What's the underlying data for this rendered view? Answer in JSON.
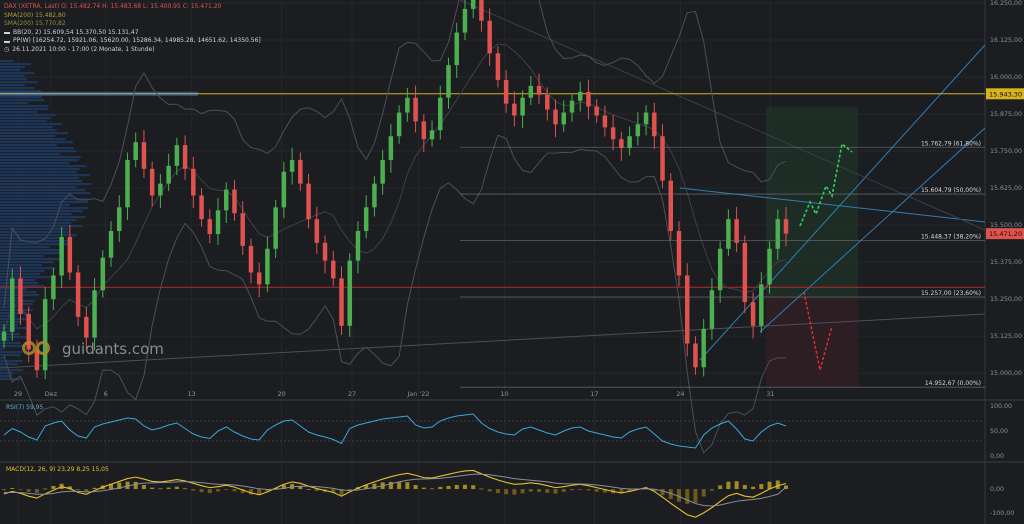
{
  "chart_data": {
    "type": "candlestick",
    "symbol_line": "DAX (XETRA, Last)  O: 15.482,74  H: 15.483,68  L: 15.400,95  C: 15.471,20",
    "legend": [
      {
        "text": "SMA(200)  15.482,80",
        "color": "#b59a3a"
      },
      {
        "text": "SMA(200)  15.770,82",
        "color": "#8a8f3a"
      },
      {
        "text": "BB(20, 2)  15.609,54  15.370,50  15.131,47",
        "color": "#cfd3d8"
      },
      {
        "text": "PP(W)  [16254.72, 15921.06, 15620.00, 15286.34, 14985.28, 14651.62, 14350.56]",
        "color": "#cfd3d8"
      },
      {
        "text": "26.11.2021 10:00 - 17:00  (2 Monate, 1 Stunde)",
        "color": "#cfd3d8"
      }
    ],
    "x_ticks": [
      "29",
      "Dez",
      "6",
      "13",
      "20",
      "27",
      "Jan '22",
      "10",
      "17",
      "24",
      "31"
    ],
    "y_ticks": [
      "16.250,00",
      "16.125,00",
      "16.000,00",
      "15.875,00",
      "15.750,00",
      "15.625,00",
      "15.500,00",
      "15.375,00",
      "15.250,00",
      "15.125,00",
      "15.000,00"
    ],
    "ylim": [
      14950,
      16260
    ],
    "price_close_series": [
      15140,
      15320,
      15200,
      15080,
      15010,
      15250,
      15330,
      15460,
      15340,
      15190,
      15120,
      15280,
      15390,
      15480,
      15560,
      15720,
      15780,
      15690,
      15600,
      15640,
      15700,
      15770,
      15690,
      15600,
      15520,
      15470,
      15550,
      15620,
      15540,
      15430,
      15340,
      15300,
      15420,
      15560,
      15680,
      15720,
      15640,
      15520,
      15440,
      15380,
      15320,
      15160,
      15380,
      15480,
      15560,
      15640,
      15720,
      15800,
      15880,
      15930,
      15850,
      15790,
      15820,
      15930,
      16040,
      16150,
      16230,
      16280,
      16190,
      16080,
      15990,
      15910,
      15870,
      15930,
      15970,
      15940,
      15890,
      15840,
      15880,
      15920,
      15950,
      15900,
      15870,
      15830,
      15790,
      15760,
      15800,
      15840,
      15880,
      15800,
      15650,
      15480,
      15330,
      15100,
      15020,
      15150,
      15280,
      15420,
      15520,
      15440,
      15240,
      15160,
      15300,
      15420,
      15520,
      15471.2
    ],
    "last_price": "15.471,20",
    "horizontal_line": {
      "label": "15.943,30",
      "value": 15943.3
    },
    "fibonacci": [
      {
        "label": "15.762,79 (61,80%)",
        "value": 15762.79
      },
      {
        "label": "15.604,79 (50,00%)",
        "value": 15604.79
      },
      {
        "label": "15.448,37 (38,20%)",
        "value": 15448.37
      },
      {
        "label": "15.257,00 (23,60%)",
        "value": 15257.0
      },
      {
        "label": "14.952,67 (0,00%)",
        "value": 14952.67
      }
    ],
    "rsi": {
      "label": "RSI(7)  59,95",
      "ticks": [
        "100,00",
        "50,00",
        "0,00"
      ],
      "ylim": [
        0,
        100
      ],
      "values": [
        42,
        55,
        48,
        38,
        32,
        60,
        66,
        70,
        52,
        40,
        36,
        58,
        64,
        68,
        72,
        76,
        74,
        60,
        52,
        56,
        62,
        66,
        55,
        44,
        38,
        35,
        50,
        58,
        48,
        40,
        34,
        32,
        52,
        62,
        70,
        72,
        60,
        48,
        42,
        38,
        33,
        25,
        55,
        62,
        66,
        70,
        74,
        76,
        78,
        80,
        62,
        56,
        58,
        70,
        76,
        80,
        82,
        84,
        66,
        55,
        48,
        44,
        42,
        54,
        58,
        52,
        46,
        42,
        50,
        56,
        58,
        50,
        46,
        42,
        38,
        36,
        48,
        54,
        58,
        44,
        30,
        24,
        20,
        18,
        16,
        42,
        56,
        64,
        70,
        54,
        34,
        30,
        48,
        60,
        66,
        59.95
      ]
    },
    "macd": {
      "label": "MACD(12, 26, 9)  23,29  8,25  15,05",
      "ticks": [
        "0,00",
        "-100,00"
      ],
      "ylim": [
        -130,
        80
      ],
      "macd": [
        -20,
        -10,
        -18,
        -30,
        -38,
        -20,
        -5,
        10,
        2,
        -14,
        -22,
        -6,
        8,
        20,
        32,
        44,
        50,
        42,
        32,
        30,
        34,
        40,
        34,
        24,
        14,
        6,
        10,
        16,
        8,
        -4,
        -16,
        -24,
        -12,
        4,
        20,
        30,
        24,
        12,
        2,
        -6,
        -14,
        -30,
        -12,
        4,
        18,
        30,
        42,
        52,
        60,
        66,
        58,
        48,
        46,
        54,
        62,
        70,
        76,
        78,
        64,
        50,
        38,
        28,
        20,
        22,
        26,
        22,
        14,
        6,
        10,
        16,
        20,
        14,
        6,
        -2,
        -10,
        -16,
        -10,
        -2,
        6,
        -10,
        -34,
        -60,
        -84,
        -108,
        -118,
        -100,
        -78,
        -52,
        -28,
        -18,
        -30,
        -34,
        -18,
        0,
        14,
        23.29
      ],
      "signal": [
        -15,
        -14,
        -15,
        -18,
        -22,
        -22,
        -18,
        -12,
        -9,
        -10,
        -12,
        -11,
        -7,
        -2,
        5,
        13,
        20,
        25,
        26,
        27,
        28,
        30,
        31,
        30,
        27,
        23,
        20,
        19,
        17,
        13,
        7,
        1,
        -2,
        -1,
        3,
        9,
        12,
        12,
        10,
        7,
        3,
        -4,
        -6,
        -4,
        1,
        7,
        14,
        22,
        30,
        37,
        41,
        42,
        43,
        45,
        49,
        53,
        58,
        62,
        62,
        60,
        55,
        50,
        44,
        40,
        37,
        34,
        30,
        25,
        22,
        21,
        21,
        20,
        17,
        13,
        8,
        3,
        0,
        0,
        1,
        -1,
        -8,
        -18,
        -31,
        -46,
        -61,
        -69,
        -71,
        -67,
        -59,
        -51,
        -47,
        -44,
        -39,
        -31,
        -22,
        8.25
      ]
    }
  }
}
